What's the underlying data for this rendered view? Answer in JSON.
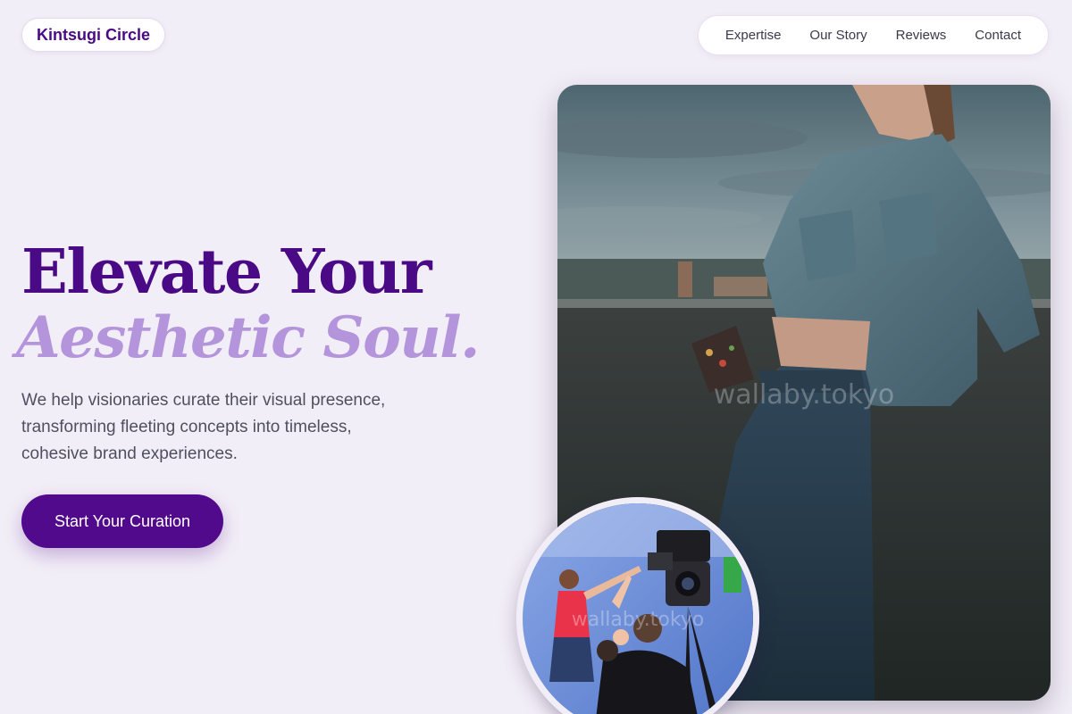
{
  "brand": {
    "name": "Kintsugi Circle"
  },
  "nav": {
    "items": [
      {
        "label": "Expertise",
        "name": "nav-link-expertise"
      },
      {
        "label": "Our Story",
        "name": "nav-link-our-story"
      },
      {
        "label": "Reviews",
        "name": "nav-link-reviews"
      },
      {
        "label": "Contact",
        "name": "nav-link-contact"
      }
    ]
  },
  "hero": {
    "title_line1": "Elevate Your",
    "title_line2": "Aesthetic Soul.",
    "subtext": "We help visionaries curate their visual presence, transforming fleeting concepts into timeless, cohesive brand experiences.",
    "cta_label": "Start Your Curation"
  },
  "images": {
    "main_watermark": "wallaby.tokyo",
    "circle_watermark": "wallaby.tokyo"
  },
  "colors": {
    "background": "#f2eef7",
    "primary": "#4a0a85",
    "accent_light": "#b495dc",
    "cta": "#520a8c"
  }
}
